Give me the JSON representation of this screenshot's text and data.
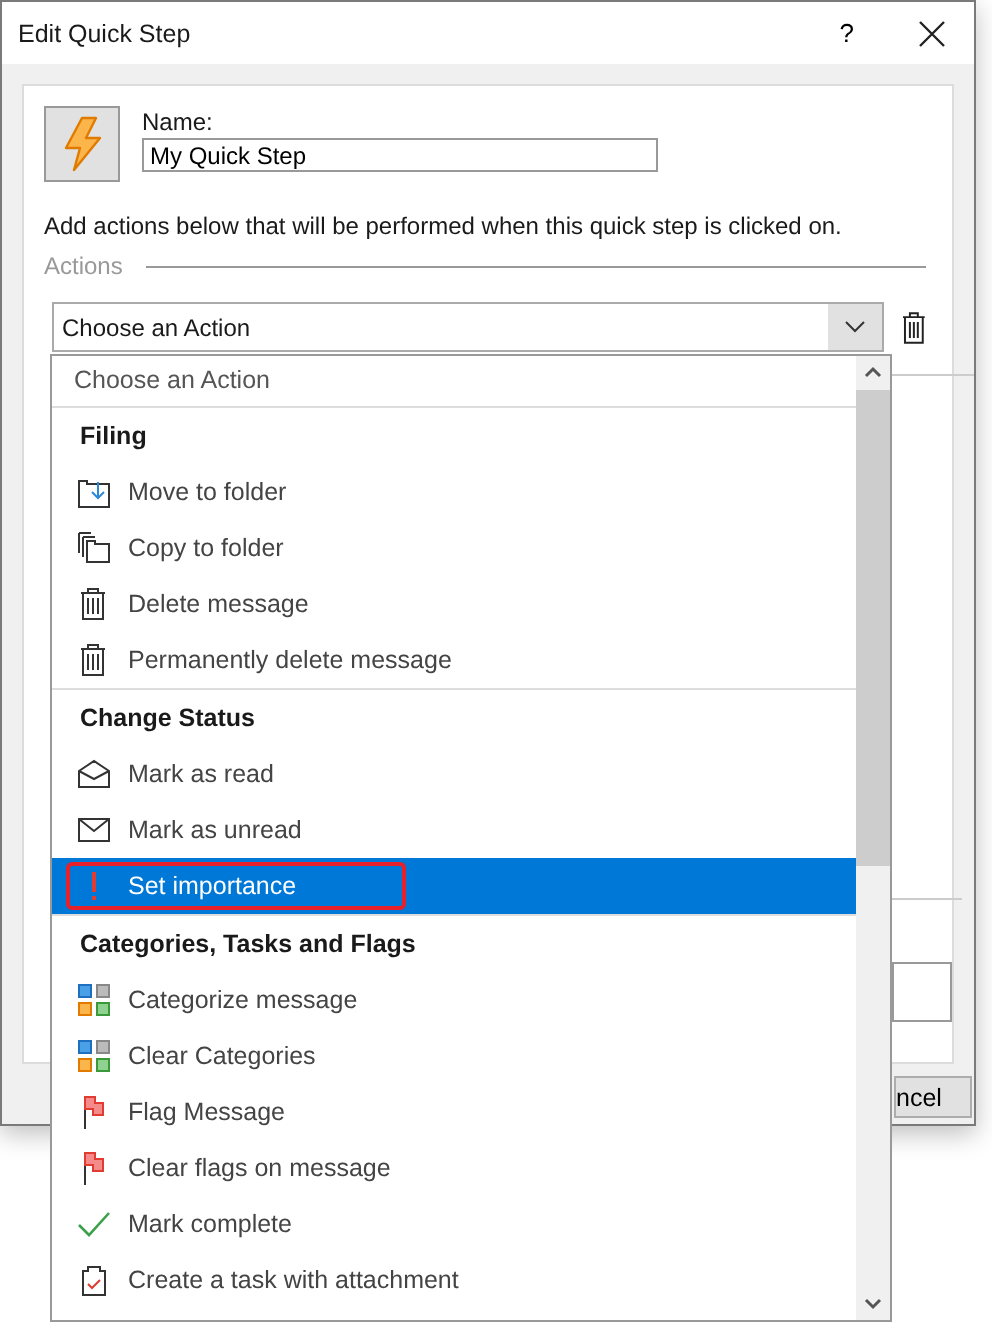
{
  "window": {
    "title": "Edit Quick Step",
    "help": "?"
  },
  "name_label": "Name:",
  "name_value": "My Quick Step",
  "description": "Add actions below that will be performed when this quick step is clicked on.",
  "actions_legend": "Actions",
  "action_combo": {
    "value": "Choose an Action"
  },
  "behind": {
    "cancel_button": "ncel"
  },
  "dropdown": {
    "first_entry": "Choose an Action",
    "groups": [
      {
        "title": "Filing",
        "items": [
          {
            "label": "Move to folder",
            "kind": "move",
            "selected": false
          },
          {
            "label": "Copy to folder",
            "kind": "copy",
            "selected": false
          },
          {
            "label": "Delete message",
            "kind": "trash",
            "selected": false
          },
          {
            "label": "Permanently delete message",
            "kind": "trash",
            "selected": false
          }
        ]
      },
      {
        "title": "Change Status",
        "items": [
          {
            "label": "Mark as read",
            "kind": "read",
            "selected": false
          },
          {
            "label": "Mark as unread",
            "kind": "unread",
            "selected": false
          },
          {
            "label": "Set importance",
            "kind": "importance",
            "selected": true
          }
        ]
      },
      {
        "title": "Categories, Tasks and Flags",
        "items": [
          {
            "label": "Categorize message",
            "kind": "categories",
            "selected": false
          },
          {
            "label": "Clear Categories",
            "kind": "categories",
            "selected": false
          },
          {
            "label": "Flag Message",
            "kind": "flag",
            "selected": false
          },
          {
            "label": "Clear flags on message",
            "kind": "flag",
            "selected": false
          },
          {
            "label": "Mark complete",
            "kind": "check",
            "selected": false
          },
          {
            "label": "Create a task with attachment",
            "kind": "task",
            "selected": false
          }
        ]
      }
    ]
  }
}
